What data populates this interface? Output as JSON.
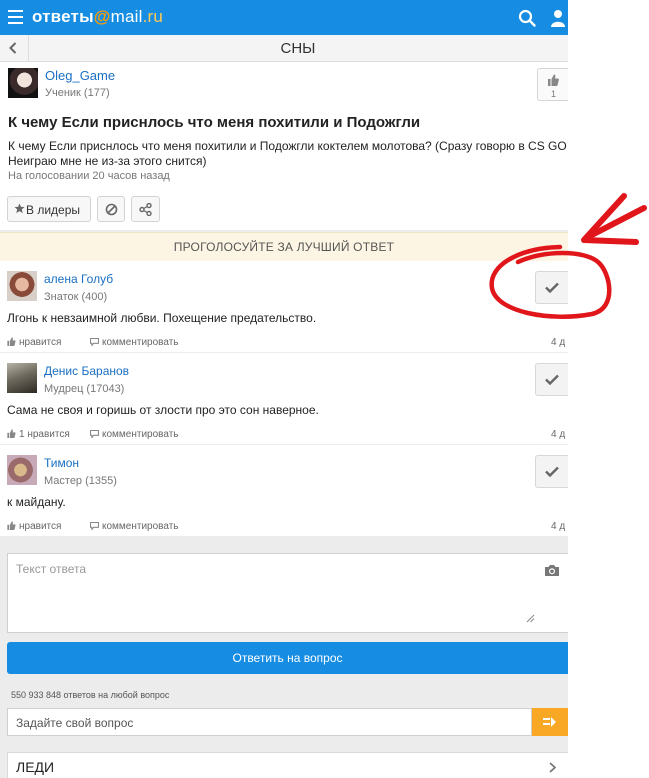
{
  "header": {
    "logo_part1": "ответы",
    "logo_at": "@",
    "logo_mail": "mail",
    "logo_ru": ".ru",
    "menu_icon": "hamburger-icon",
    "search_icon": "search-icon",
    "user_icon": "user-icon"
  },
  "category": {
    "back_icon": "chevron-left-icon",
    "title": "СНЫ"
  },
  "question": {
    "author": "Oleg_Game",
    "rank": "Ученик (177)",
    "likes": "1",
    "title": "К чему Если приснлось что меня похитили и Подожгли",
    "text": "К чему Если приснлось что меня похитили и Подожгли коктелем молотова? (Сразу говорю в CS GO Неиграю мне не из-за этого снится)",
    "meta": "На голосовании 20 часов назад",
    "leader_button": "В лидеры"
  },
  "vote_banner": "ПРОГОЛОСУЙТЕ ЗА ЛУЧШИЙ ОТВЕТ",
  "answers": [
    {
      "author": "алена Голуб",
      "rank": "Знаток (400)",
      "text": "Лгонь к невзаимной любви. Похещение предательство.",
      "like_label": "нравится",
      "comment_label": "комментировать",
      "date": "4 д"
    },
    {
      "author": "Денис Баранов",
      "rank": "Мудрец (17043)",
      "text": "Сама не своя и горишь от злости про это сон наверное.",
      "like_label": "1 нравится",
      "comment_label": "комментировать",
      "date": "4 д"
    },
    {
      "author": "Тимон",
      "rank": "Мастер (1355)",
      "text": "к майдану.",
      "like_label": "нравится",
      "comment_label": "комментировать",
      "date": "4 д"
    }
  ],
  "reply": {
    "placeholder": "Текст ответа",
    "submit_label": "Ответить на вопрос",
    "stat": "550 933 848 ответов на любой вопрос"
  },
  "ask": {
    "placeholder": "Задайте свой вопрос"
  },
  "nav": {
    "item": "ЛЕДИ"
  },
  "colors": {
    "brand_blue": "#168de2",
    "banner_bg": "#fcf5e3",
    "ask_orange": "#f9a825",
    "annotation_red": "#e0161b"
  }
}
